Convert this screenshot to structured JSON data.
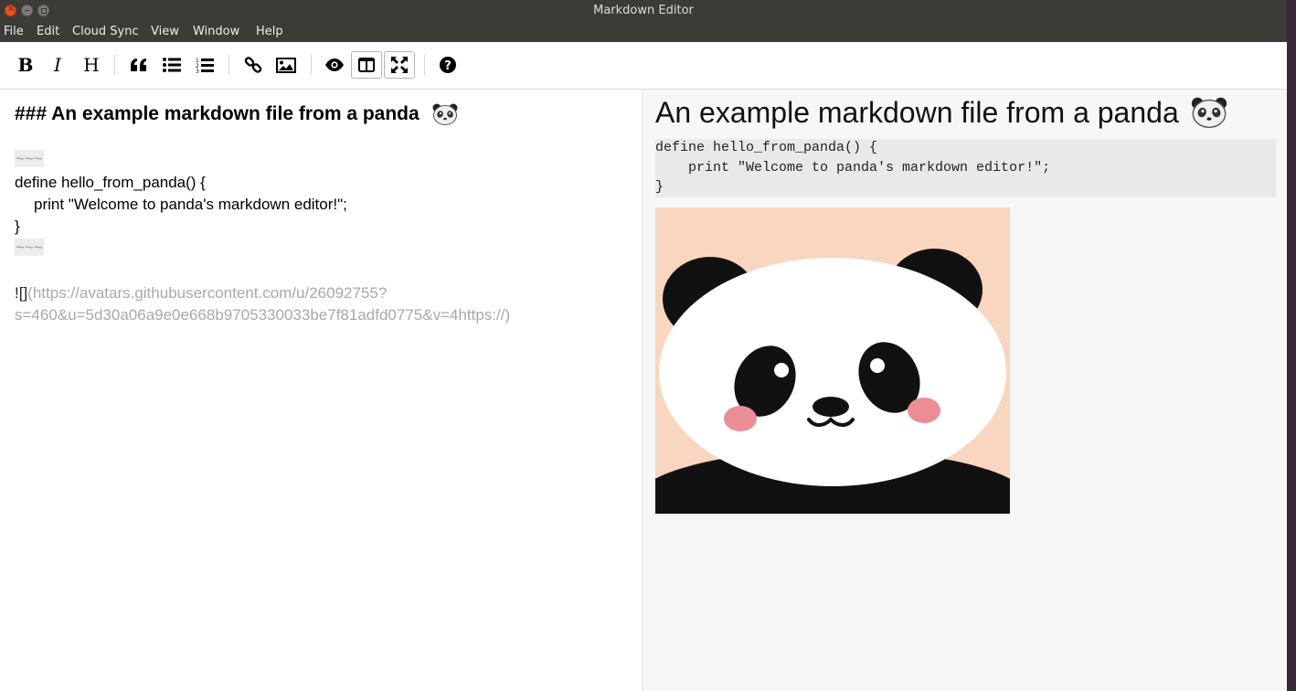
{
  "window": {
    "title": "Markdown Editor"
  },
  "menu": [
    "File",
    "Edit",
    "Cloud Sync",
    "View",
    "Window",
    "Help"
  ],
  "toolbar": {
    "bold": "B",
    "italic": "I",
    "heading": "H",
    "icons": [
      "quote-icon",
      "bullet-list-icon",
      "numbered-list-icon",
      "link-icon",
      "image-icon",
      "preview-eye-icon",
      "side-by-side-icon",
      "fullscreen-icon",
      "help-icon"
    ],
    "active": [
      "side-by-side-icon",
      "fullscreen-icon"
    ]
  },
  "editor": {
    "heading": "### An example markdown file from a panda",
    "fence": "~~~",
    "code_lines": [
      "define hello_from_panda() {",
      "print \"Welcome to panda's markdown editor!\";",
      "}"
    ],
    "image_prefix": "![]",
    "image_url_line1": "(https://avatars.githubusercontent.com/u/26092755?",
    "image_url_line2": "s=460&u=5d30a06a9e0e668b9705330033be7f81adfd0775&v=4https://)"
  },
  "preview": {
    "heading": "An example markdown file from a panda",
    "code_lines": [
      "define hello_from_panda() {",
      "    print \"Welcome to panda's markdown editor!\";",
      "}"
    ]
  },
  "colors": {
    "titlebar": "#3c3b37",
    "close_button": "#e95420",
    "preview_bg": "#f7f7f7"
  }
}
